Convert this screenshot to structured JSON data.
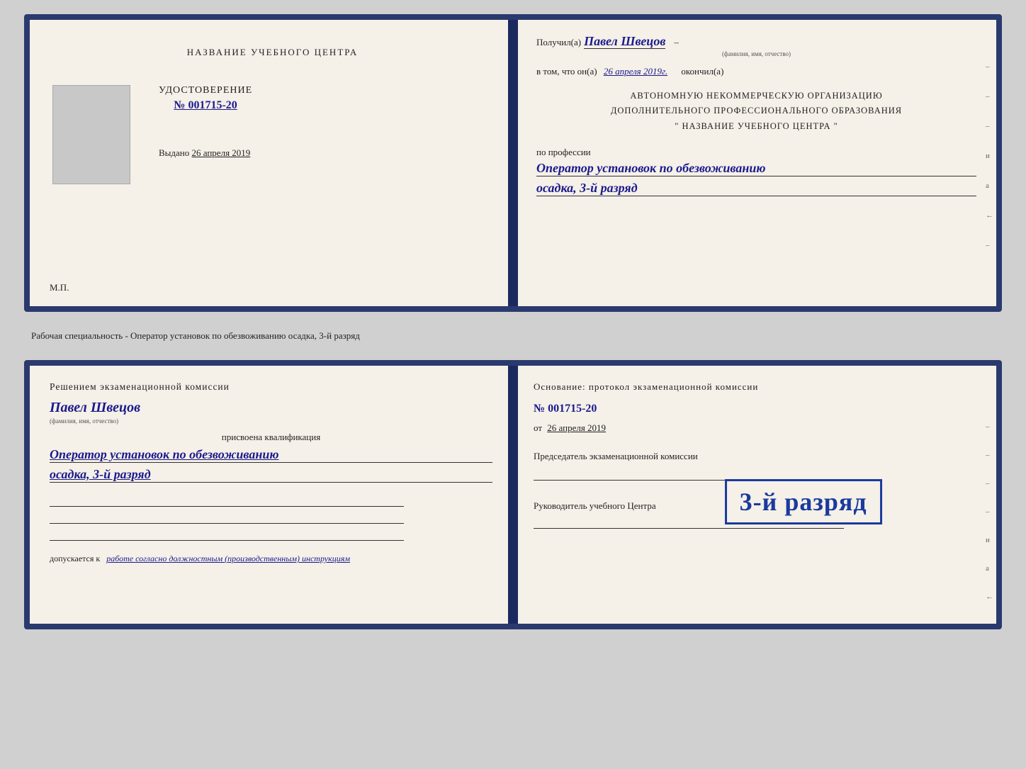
{
  "top_card": {
    "left": {
      "center_title": "НАЗВАНИЕ УЧЕБНОГО ЦЕНТРА",
      "photo_alt": "photo",
      "cert_label": "УДОСТОВЕРЕНИЕ",
      "cert_number": "№ 001715-20",
      "issued_label": "Выдано",
      "issued_date": "26 апреля 2019",
      "mp_label": "М.П."
    },
    "right": {
      "received_prefix": "Получил(а)",
      "received_name": "Павел Швецов",
      "fio_subtitle": "(фамилия, имя, отчество)",
      "dash": "–",
      "vtom_prefix": "в том, что он(а)",
      "vtom_date": "26 апреля 2019г.",
      "okончил": "окончил(а)",
      "org_line1": "АВТОНОМНУЮ НЕКОММЕРЧЕСКУЮ ОРГАНИЗАЦИЮ",
      "org_line2": "ДОПОЛНИТЕЛЬНОГО ПРОФЕССИОНАЛЬНОГО ОБРАЗОВАНИЯ",
      "org_line3": "\"  НАЗВАНИЕ УЧЕБНОГО ЦЕНТРА  \"",
      "po_professii": "по профессии",
      "profession": "Оператор установок по обезвоживанию",
      "razryad": "осадка, 3-й разряд",
      "side_marks": [
        "–",
        "–",
        "–",
        "и",
        "а",
        "←",
        "–"
      ]
    }
  },
  "subtitle": {
    "text": "Рабочая специальность - Оператор установок по обезвоживанию осадка, 3-й разряд"
  },
  "bottom_card": {
    "left": {
      "resheniyem": "Решением  экзаменационной  комиссии",
      "name": "Павел Швецов",
      "fio_sub": "(фамилия, имя, отчество)",
      "prisvoyena": "присвоена квалификация",
      "kvalif1": "Оператор установок по обезвоживанию",
      "kvalif2": "осадка, 3-й разряд",
      "dopusk_prefix": "допускается к",
      "dopusk_value": "работе согласно должностным (производственным) инструкциям"
    },
    "right": {
      "osnov_label": "Основание: протокол экзаменационной  комиссии",
      "osnov_number": "№  001715-20",
      "ot_prefix": "от",
      "ot_date": "26 апреля 2019",
      "predsedatel": "Председатель экзаменационной комиссии",
      "rukovoditel": "Руководитель учебного Центра",
      "side_marks": [
        "–",
        "–",
        "–",
        "–",
        "и",
        "а",
        "←",
        "–"
      ]
    },
    "stamp": {
      "text": "3-й разряд"
    }
  }
}
